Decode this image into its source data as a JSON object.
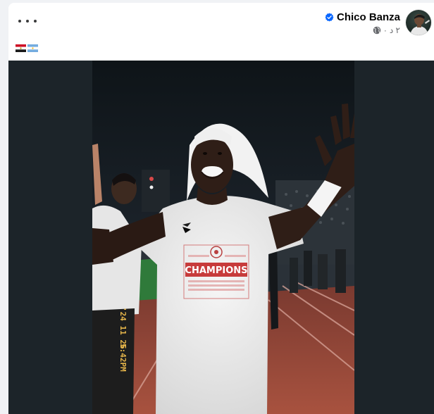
{
  "post": {
    "author_name": "Chico Banza",
    "timestamp": "٢ د",
    "privacy_icon": "globe-icon",
    "verified_icon": "verified-badge-icon",
    "more_icon": "more-options-icon",
    "body_flags": [
      "egypt-flag-emoji",
      "argentina-flag-emoji"
    ]
  },
  "photo": {
    "shirt_text": "CHAMPIONS",
    "date_stamp": "'24 11 26",
    "time_stamp": "5:42PM"
  },
  "colors": {
    "card_background": "#ffffff",
    "page_background": "#f0f2f5",
    "media_background": "#1c2429",
    "author_name": "#050505",
    "meta_text": "#65676b",
    "verified_blue": "#0866ff"
  }
}
